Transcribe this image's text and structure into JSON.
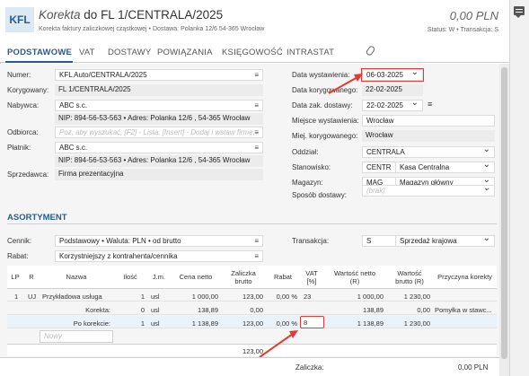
{
  "header": {
    "logo": "KFL",
    "title_prefix": "Korekta",
    "title_rest": "do FL 1/CENTRALA/2025",
    "subtitle": "Korekta faktury zaliczkowej cząstkowej  •  Dostawa: Polanka  12/6  54-365 Wrocław",
    "amount": "0,00 PLN",
    "status": "Status:  W  •  Transakcja:  S"
  },
  "tabs": [
    "PODSTAWOWE",
    "VAT",
    "DOSTAWY",
    "POWIĄZANIA",
    "KSIĘGOWOŚĆ",
    "INTRASTAT"
  ],
  "left": {
    "numer_label": "Numer:",
    "numer": "KFL Auto/CENTRALA/2025",
    "korygowany_label": "Korygowany:",
    "korygowany": "FL 1/CENTRALA/2025",
    "nabywca_label": "Nabywca:",
    "nabywca": "ABC s.c.",
    "nabywca_addr": "NIP:  894-56-53-563  •  Adres:  Polanka  12/6 , 54-365 Wrocław",
    "odbiorca_label": "Odbiorca:",
    "odbiorca_placeholder": "Poz, aby wyszukać, [F2] - Lista, [Insert] - Dodaj i wstaw firmę;",
    "platnik_label": "Płatnik:",
    "platnik": "ABC s.c.",
    "platnik_addr": "NIP:  894-56-53-563  •  Adres:  Polanka  12/6 , 54-365 Wrocław",
    "sprzedawca_label": "Sprzedawca:",
    "sprzedawca": "Firma prezentacyjna"
  },
  "right": {
    "data_wyst_label": "Data wystawienia:",
    "data_wyst": "06-03-2025",
    "data_kor_label": "Data korygowanego:",
    "data_kor": "22-02-2025",
    "data_zak_label": "Data zak. dostawy:",
    "data_zak": "22-02-2025",
    "miejsce_label": "Miejsce wystawienia:",
    "miejsce": "Wrocław",
    "miej_kor_label": "Miej. korygowanego:",
    "miej_kor": "Wrocław",
    "oddzial_label": "Oddział:",
    "oddzial": "CENTRALA",
    "stanowisko_label": "Stanowisko:",
    "stanowisko_code": "CENTR",
    "stanowisko": "Kasa Centralna",
    "magazyn_label": "Magazyn:",
    "magazyn_code": "MAG",
    "magazyn": "Magazyn główny",
    "sposob_label": "Sposób dostawy:",
    "sposob": "(brak)"
  },
  "asortyment": {
    "title": "ASORTYMENT",
    "cennik_label": "Cennik:",
    "cennik": "Podstawowy  •  Waluta: PLN  •  od brutto",
    "rabat_label": "Rabat:",
    "rabat": "Korzystniejszy z kontrahenta/cennika",
    "transakcja_label": "Transakcja:",
    "transakcja_code": "S",
    "transakcja": "Sprzedaż krajowa"
  },
  "table": {
    "headers": [
      "LP",
      "R",
      "Nazwa",
      "Ilość",
      "J.m.",
      "Cena netto",
      "Zaliczka\nbrutto",
      "Rabat",
      "VAT\n[%]",
      "Wartość netto\n(R)",
      "Wartość\nbrutto (R)",
      "Przyczyna korekty"
    ],
    "rows": [
      {
        "lp": "1",
        "r": "UJ",
        "nazwa": "Przykładowa usługa",
        "ilosc": "1",
        "jm": "usl",
        "cena": "1 000,00",
        "zaliczka": "123,00",
        "rabat": "0,00 %",
        "vat": "23",
        "netto": "1 000,00",
        "brutto": "1 230,00",
        "przyczyna": ""
      },
      {
        "lp": "",
        "r": "",
        "nazwa": "Korekta:",
        "ilosc": "0",
        "jm": "usl",
        "cena": "138,89",
        "zaliczka": "0,00",
        "rabat": "",
        "vat": "",
        "netto": "138,89",
        "brutto": "0,00",
        "przyczyna": "Pomyłka w stawc..."
      },
      {
        "lp": "",
        "r": "",
        "nazwa": "Po korekcie:",
        "ilosc": "1",
        "jm": "usl",
        "cena": "1 138,89",
        "zaliczka": "123,00",
        "rabat": "0,00 %",
        "vat": "8",
        "netto": "1 138,89",
        "brutto": "1 230,00",
        "przyczyna": ""
      }
    ],
    "new_row_placeholder": "Nowy",
    "sum_zaliczka": "123,00"
  },
  "footer": {
    "zaliczka_label": "Zaliczka:",
    "zaliczka": "0,00 PLN"
  },
  "colors": {
    "accent": "#2a5b8c",
    "highlight": "#e53935"
  }
}
